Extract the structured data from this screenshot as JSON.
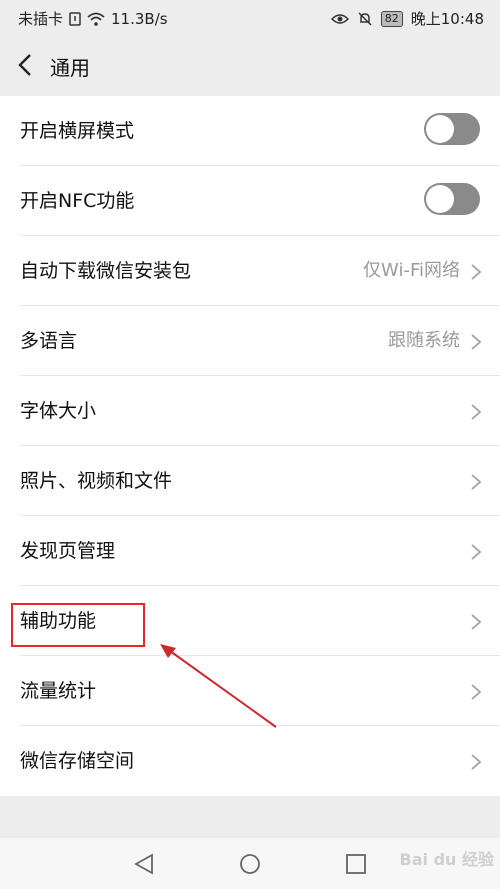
{
  "status_bar": {
    "carrier": "未插卡",
    "speed": "11.3B/s",
    "battery": "82",
    "time": "晚上10:48"
  },
  "header": {
    "title": "通用"
  },
  "settings": [
    {
      "label": "开启横屏模式",
      "type": "toggle",
      "on": false
    },
    {
      "label": "开启NFC功能",
      "type": "toggle",
      "on": false
    },
    {
      "label": "自动下载微信安装包",
      "value": "仅Wi-Fi网络"
    },
    {
      "label": "多语言",
      "value": "跟随系统"
    },
    {
      "label": "字体大小"
    },
    {
      "label": "照片、视频和文件"
    },
    {
      "label": "发现页管理"
    },
    {
      "label": "辅助功能"
    },
    {
      "label": "流量统计"
    },
    {
      "label": "微信存储空间"
    }
  ],
  "watermark": "Bai du 经验",
  "colors": {
    "highlight": "#e8262a",
    "toggle_off": "#8a8a8a"
  }
}
